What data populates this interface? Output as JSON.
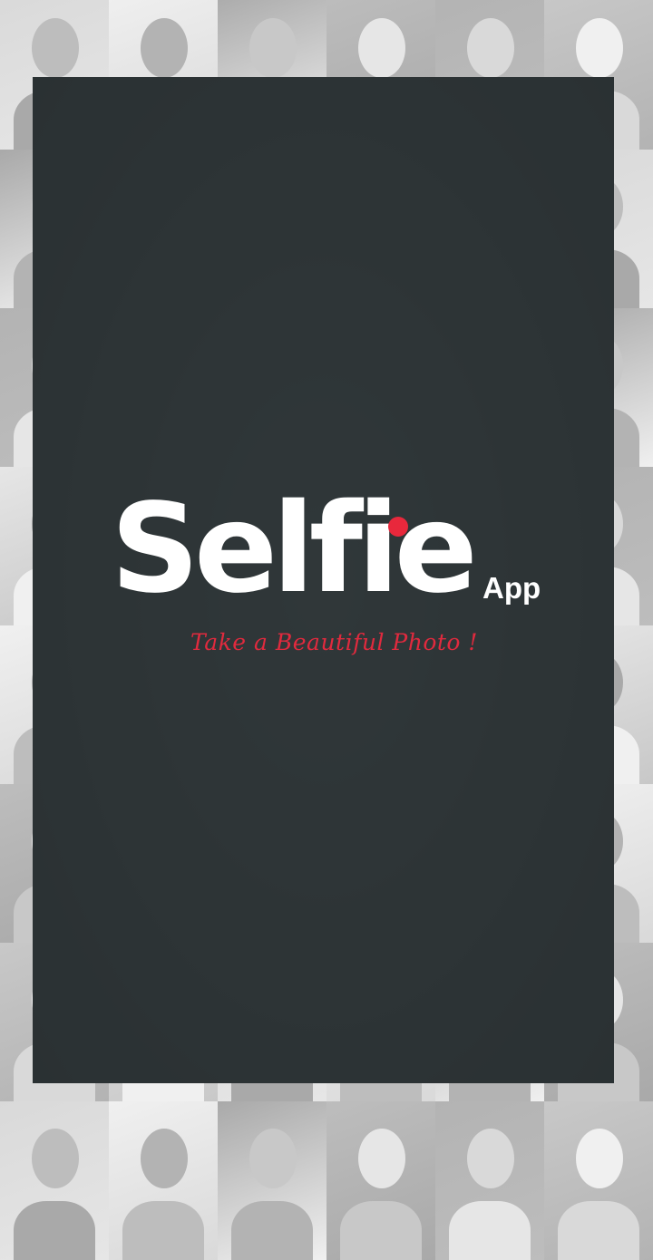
{
  "splash": {
    "logo_word": "Selfie",
    "logo_suffix": "App",
    "tagline": "Take a Beautiful Photo !"
  },
  "colors": {
    "panel_background": "#2d3436",
    "logo_text": "#ffffff",
    "accent_red": "#e8283c",
    "tagline_red": "#e02a3e"
  }
}
